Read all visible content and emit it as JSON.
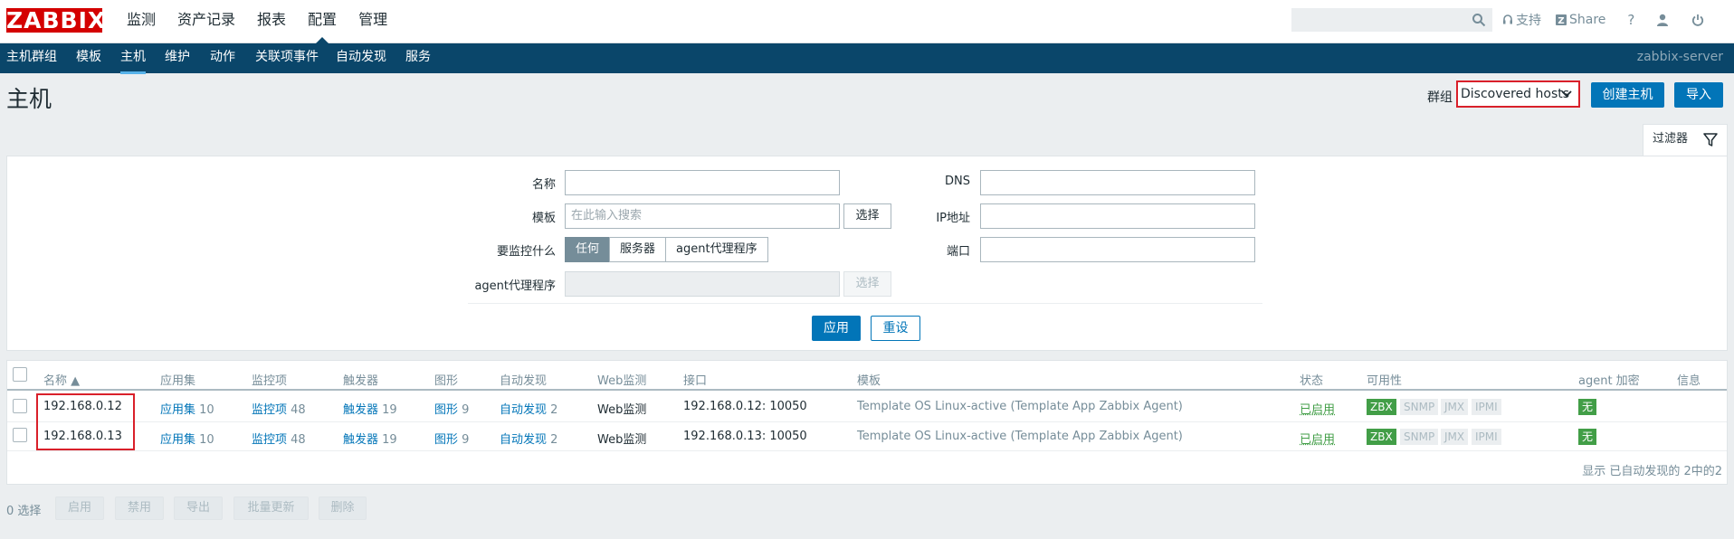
{
  "header": {
    "logo": "ZABBIX",
    "nav": [
      "监测",
      "资产记录",
      "报表",
      "配置",
      "管理"
    ],
    "active_nav": "配置",
    "search_placeholder": "",
    "support_label": "支持",
    "share_label": "Share",
    "help_label": "?"
  },
  "subnav": {
    "items": [
      "主机群组",
      "模板",
      "主机",
      "维护",
      "动作",
      "关联项事件",
      "自动发现",
      "服务"
    ],
    "active": "主机",
    "server": "zabbix-server"
  },
  "page": {
    "title": "主机",
    "group_label": "群组",
    "group_value": "Discovered hosts",
    "create_button": "创建主机",
    "import_button": "导入"
  },
  "filter": {
    "tab_label": "过滤器",
    "name_label": "名称",
    "name_value": "",
    "template_label": "模板",
    "template_placeholder": "在此输入搜索",
    "select_label": "选择",
    "monitored_by_label": "要监控什么",
    "monitored_by_options": [
      "任何",
      "服务器",
      "agent代理程序"
    ],
    "proxy_label": "agent代理程序",
    "proxy_select_label": "选择",
    "dns_label": "DNS",
    "ip_label": "IP地址",
    "port_label": "端口",
    "apply_button": "应用",
    "reset_button": "重设"
  },
  "table": {
    "headers": [
      "名称 ▲",
      "应用集",
      "监控项",
      "触发器",
      "图形",
      "自动发现",
      "Web监测",
      "接口",
      "模板",
      "状态",
      "可用性",
      "agent 加密",
      "信息"
    ],
    "rows": [
      {
        "name": "192.168.0.12",
        "apps_label": "应用集",
        "apps_count": "10",
        "items_label": "监控项",
        "items_count": "48",
        "triggers_label": "触发器",
        "triggers_count": "19",
        "graphs_label": "图形",
        "graphs_count": "9",
        "discovery_label": "自动发现",
        "discovery_count": "2",
        "web_label": "Web监测",
        "interface": "192.168.0.12: 10050",
        "template": "Template OS Linux-active",
        "template_paren": "(Template App Zabbix Agent)",
        "status": "已启用",
        "availability": [
          "ZBX",
          "SNMP",
          "JMX",
          "IPMI"
        ],
        "encryption": "无"
      },
      {
        "name": "192.168.0.13",
        "apps_label": "应用集",
        "apps_count": "10",
        "items_label": "监控项",
        "items_count": "48",
        "triggers_label": "触发器",
        "triggers_count": "19",
        "graphs_label": "图形",
        "graphs_count": "9",
        "discovery_label": "自动发现",
        "discovery_count": "2",
        "web_label": "Web监测",
        "interface": "192.168.0.13: 10050",
        "template": "Template OS Linux-active",
        "template_paren": "(Template App Zabbix Agent)",
        "status": "已启用",
        "availability": [
          "ZBX",
          "SNMP",
          "JMX",
          "IPMI"
        ],
        "encryption": "无"
      }
    ],
    "summary": "显示 已自动发现的 2中的2"
  },
  "actions": {
    "selected": "0 选择",
    "buttons": [
      "启用",
      "禁用",
      "导出",
      "批量更新",
      "删除"
    ]
  },
  "colors": {
    "brand": "#d40000",
    "subnav_bg": "#0a466a",
    "link": "#0275b8",
    "enabled": "#429e47",
    "highlight_box": "#d9202a"
  }
}
